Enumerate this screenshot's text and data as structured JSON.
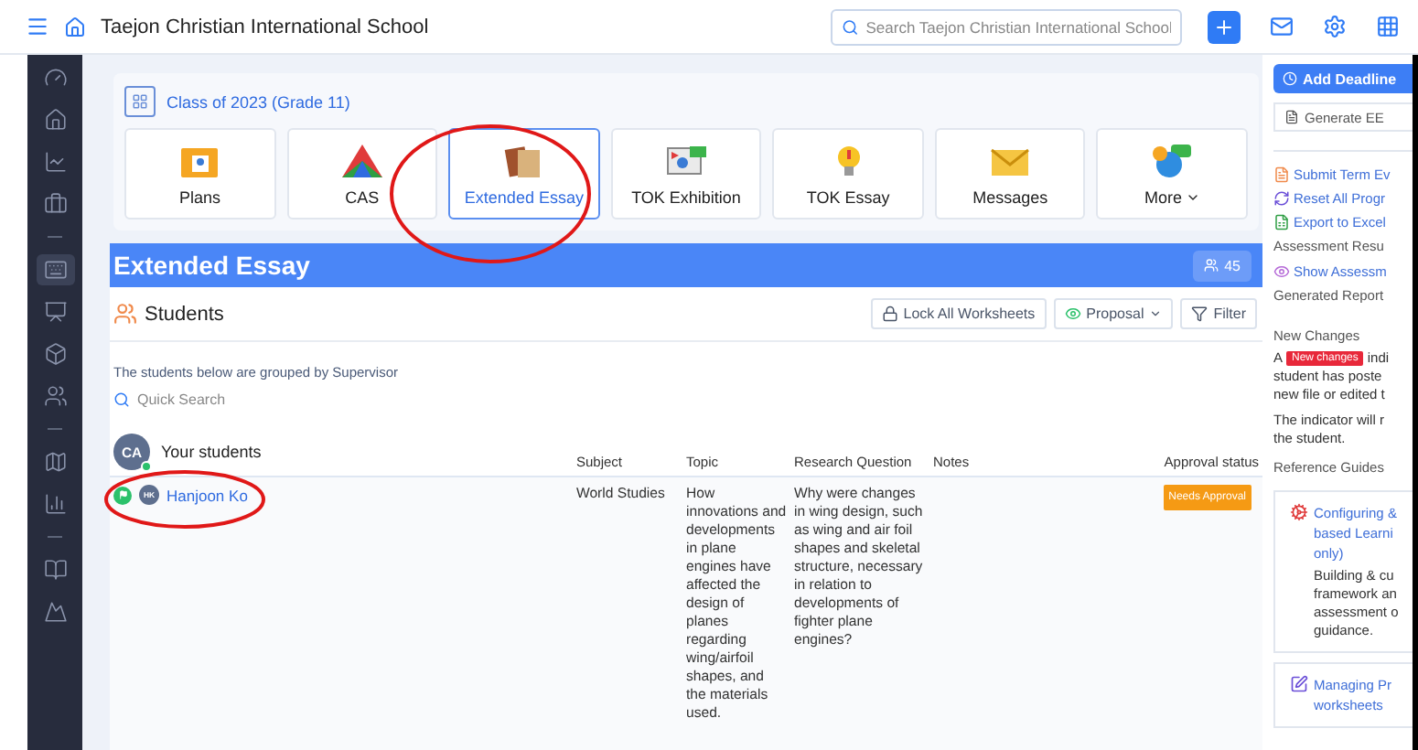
{
  "topbar": {
    "title": "Taejon Christian International School",
    "search_placeholder": "Search Taejon Christian International School"
  },
  "sidebar": {
    "groups": [
      [
        {
          "selected": false
        },
        {
          "selected": false
        },
        {
          "selected": false
        },
        {
          "selected": false
        }
      ],
      [
        {
          "selected": true
        },
        {
          "selected": false
        },
        {
          "selected": false
        },
        {
          "selected": false
        }
      ],
      [
        {
          "selected": false
        },
        {
          "selected": false
        }
      ],
      [
        {
          "selected": false
        },
        {
          "selected": false
        }
      ]
    ]
  },
  "class_label": "Class of 2023 (Grade 11)",
  "tiles": [
    {
      "label": "Plans",
      "kind": "folder",
      "selected": false
    },
    {
      "label": "CAS",
      "kind": "triangle",
      "selected": false
    },
    {
      "label": "Extended Essay",
      "kind": "books",
      "selected": true
    },
    {
      "label": "TOK Exhibition",
      "kind": "screen",
      "selected": false
    },
    {
      "label": "TOK Essay",
      "kind": "bulb",
      "selected": false
    },
    {
      "label": "Messages",
      "kind": "envelope",
      "selected": false
    },
    {
      "label": "More",
      "kind": "chat",
      "selected": false,
      "dropdown": true
    }
  ],
  "section": {
    "title": "Extended Essay",
    "count": "45"
  },
  "students": {
    "title": "Students",
    "buttons": [
      {
        "label": "Lock All Worksheets",
        "kind": "lock"
      },
      {
        "label": "Proposal",
        "kind": "eye"
      },
      {
        "label": "Filter",
        "kind": "filter"
      }
    ],
    "note": "The students below are grouped by Supervisor",
    "search_placeholder": "Quick Search",
    "group": {
      "initials": "CA",
      "title": "Your students",
      "online": true
    },
    "columns": [
      "Subject",
      "Topic",
      "Research Question",
      "Notes",
      "Approval status"
    ],
    "rows": [
      {
        "initials": "HK",
        "name": "Hanjoon Ko",
        "flag": true,
        "subject": "World Studies",
        "topic": "How innovations and developments in plane engines have affected the design of planes regarding wing/airfoil shapes, and the materials used.",
        "question": "Why were changes in wing design, such as wing and air foil shapes and skeletal structure, necessary in relation to developments of fighter plane engines?",
        "status": "Needs Approval"
      }
    ]
  },
  "right_panel": {
    "primary": "Add Deadline",
    "secondary": "Generate EE",
    "links": [
      {
        "label": "Submit Term Ev",
        "kind": "doc"
      },
      {
        "label": "Reset All Progr",
        "kind": "refresh"
      },
      {
        "label": "Export to Excel",
        "kind": "excel"
      }
    ],
    "heading_1": "Assessment Resu",
    "link_2": "Show Assessm",
    "heading_2": "Generated Report",
    "changes_title": "New Changes",
    "changes_lines": [
      "A",
      "New changes",
      "indi",
      "student has poste",
      "new file or edited t"
    ],
    "indicator_lines": [
      "The indicator will r",
      "the student."
    ],
    "guides_title": "Reference Guides",
    "guides": [
      {
        "title_lines": [
          "Configuring &",
          "based Learni",
          "only)"
        ],
        "body_lines": [
          "Building & cu",
          "framework an",
          "assessment o",
          "guidance."
        ],
        "kind": "gear"
      },
      {
        "title_lines": [
          "Managing Pr",
          "worksheets"
        ],
        "kind": "edit"
      }
    ]
  },
  "annotations": [
    {
      "kind": "ellipse"
    },
    {
      "kind": "ellipse"
    }
  ]
}
